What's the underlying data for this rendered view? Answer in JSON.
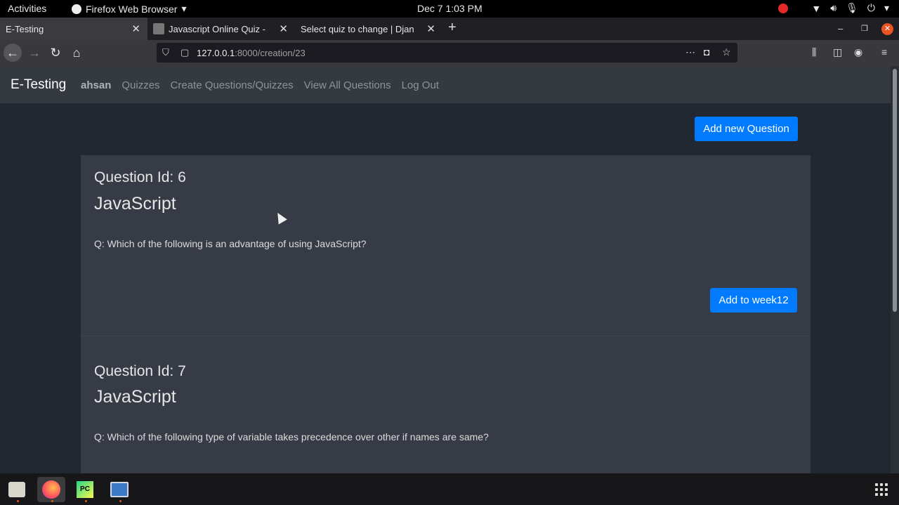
{
  "topbar": {
    "activities": "Activities",
    "app_menu": "Firefox Web Browser",
    "clock": "Dec 7  1:03 PM"
  },
  "tabs": [
    {
      "label": "E-Testing",
      "active": true
    },
    {
      "label": "Javascript Online Quiz - ",
      "active": false
    },
    {
      "label": "Select quiz to change | Djan",
      "active": false
    }
  ],
  "urlbar": {
    "host": "127.0.0.1",
    "path": ":8000/creation/23"
  },
  "site": {
    "brand": "E-Testing",
    "user": "ahsan",
    "links": [
      "Quizzes",
      "Create Questions/Quizzes",
      "View All Questions",
      "Log Out"
    ],
    "add_new_question": "Add new Question"
  },
  "questions": [
    {
      "id_label": "Question Id: 6",
      "subject": "JavaScript",
      "text": "Q: Which of the following is an advantage of using JavaScript?",
      "add_button": "Add to week12"
    },
    {
      "id_label": "Question Id: 7",
      "subject": "JavaScript",
      "text": "Q: Which of the following type of variable takes precedence over other if names are same?"
    }
  ],
  "colors": {
    "primary": "#007bff",
    "page_bg": "#222831",
    "card_bg": "#373b45",
    "navbar_bg": "#343a40"
  },
  "icons": {
    "dock": [
      "files-icon",
      "firefox-icon",
      "pycharm-icon",
      "screenshot-icon"
    ]
  }
}
